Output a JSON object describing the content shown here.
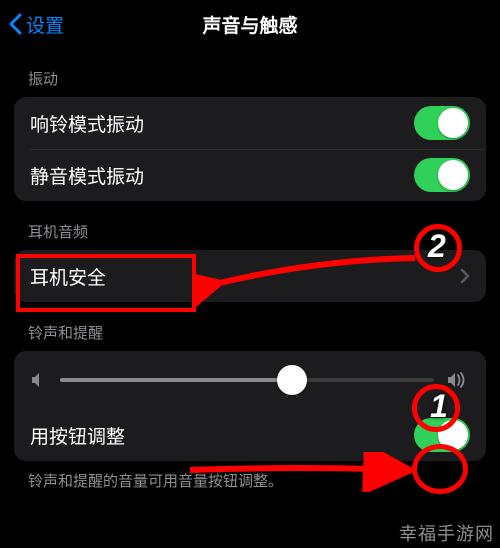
{
  "nav": {
    "back_label": "设置",
    "title": "声音与触感"
  },
  "sections": {
    "vibration": {
      "header": "振动",
      "ring_label": "响铃模式振动",
      "ring_on": true,
      "silent_label": "静音模式振动",
      "silent_on": true
    },
    "headphone": {
      "header": "耳机音频",
      "safety_label": "耳机安全"
    },
    "ringer": {
      "header": "铃声和提醒",
      "slider_percent": 62,
      "button_adjust_label": "用按钮调整",
      "button_adjust_on": true,
      "footer": "铃声和提醒的音量可用音量按钮调整。"
    }
  },
  "annotations": {
    "marker1": "1",
    "marker2": "2"
  },
  "watermark": "幸福手游网"
}
